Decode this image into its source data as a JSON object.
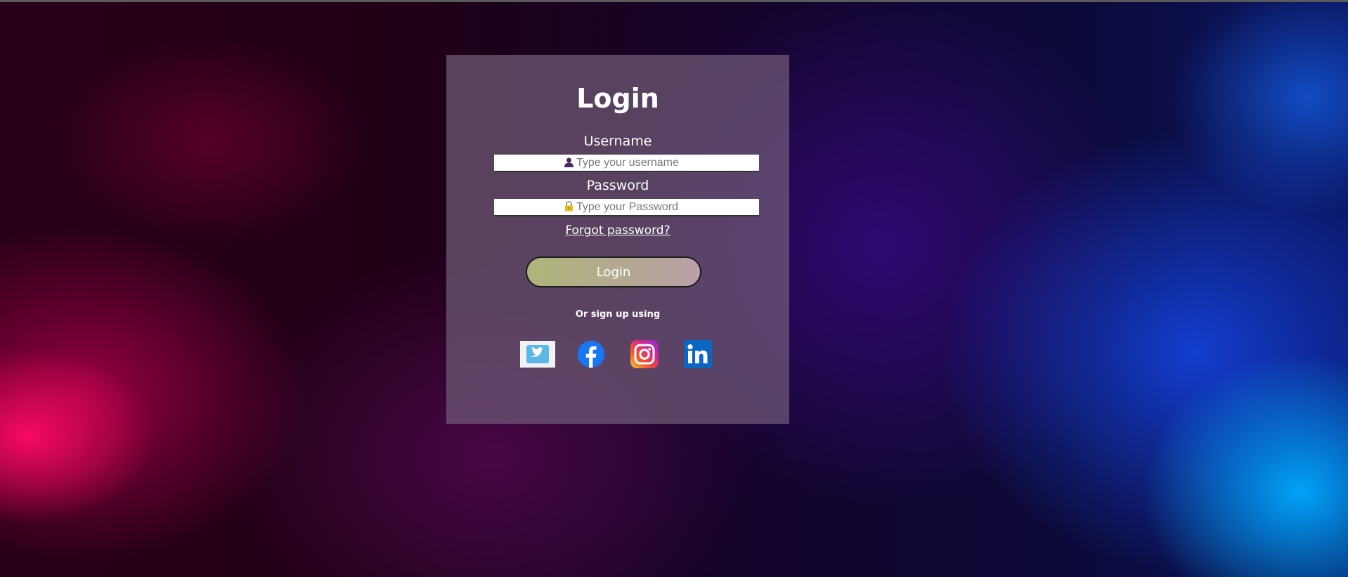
{
  "page": {
    "title": "Login"
  },
  "form": {
    "username_label": "Username",
    "username_placeholder": "Type your username",
    "username_icon": "user-icon",
    "password_label": "Password",
    "password_placeholder": "Type your Password",
    "password_icon": "lock-icon",
    "forgot_label": "Forgot password?",
    "login_label": "Login",
    "signup_text": "Or sign up using"
  },
  "social": [
    {
      "name": "twitter",
      "icon": "twitter-icon"
    },
    {
      "name": "facebook",
      "icon": "facebook-icon"
    },
    {
      "name": "instagram",
      "icon": "instagram-icon"
    },
    {
      "name": "linkedin",
      "icon": "linkedin-icon"
    }
  ],
  "colors": {
    "card_background": "#705c78",
    "button_gradient_start": "#aeb57a",
    "button_gradient_end": "#bba0a8",
    "facebook_blue": "#1877f2",
    "linkedin_blue": "#0a66c2",
    "twitter_blue": "#1da1f2"
  }
}
